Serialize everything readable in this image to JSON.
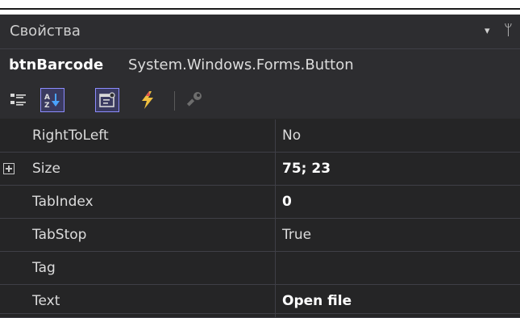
{
  "panel": {
    "title": "Свойства",
    "dropdown_glyph": "▾",
    "pin_glyph": "ᛘ"
  },
  "object": {
    "name": "btnBarcode",
    "type": "System.Windows.Forms.Button"
  },
  "toolbar": {
    "buttons": [
      {
        "icon": "categorized-icon",
        "selected": false
      },
      {
        "icon": "alphabetical-sort-icon",
        "selected": true
      },
      {
        "icon": "properties-icon",
        "selected": true
      },
      {
        "icon": "events-lightning-icon",
        "selected": false
      },
      {
        "icon": "property-pages-wrench-icon",
        "selected": false
      }
    ]
  },
  "properties": [
    {
      "name": "RightToLeft",
      "value": "No",
      "bold": false,
      "expandable": false
    },
    {
      "name": "Size",
      "value": "75; 23",
      "bold": true,
      "expandable": true
    },
    {
      "name": "TabIndex",
      "value": "0",
      "bold": true,
      "expandable": false
    },
    {
      "name": "TabStop",
      "value": "True",
      "bold": false,
      "expandable": false
    },
    {
      "name": "Tag",
      "value": "",
      "bold": false,
      "expandable": false
    },
    {
      "name": "Text",
      "value": "Open file",
      "bold": true,
      "expandable": false
    }
  ],
  "colors": {
    "background": "#252526",
    "header": "#2d2d30",
    "selected_button_border": "#8c8cff",
    "grid_line": "#3f3f46"
  }
}
